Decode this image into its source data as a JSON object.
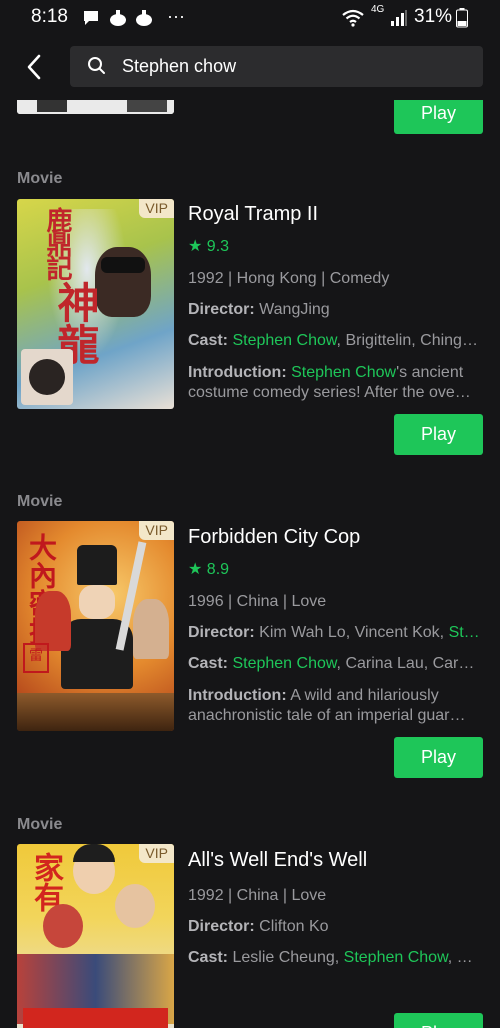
{
  "status_bar": {
    "time": "8:18",
    "more": "···",
    "network": "4G",
    "battery": "31%"
  },
  "search": {
    "value": "Stephen chow"
  },
  "play_label": "Play",
  "section_label": "Movie",
  "labels": {
    "director": "Director:",
    "cast": "Cast:",
    "introduction": "Introduction:"
  },
  "highlight_color": "#1ec659",
  "results": [
    {
      "vip": "VIP",
      "title": "Royal Tramp II",
      "rating": "9.3",
      "meta": "1992 | Hong Kong | Comedy",
      "director": "WangJing",
      "cast_hl": "Stephen Chow",
      "cast_rest": ", Brigittelin, Ching…",
      "intro_hl": "Stephen Chow",
      "intro_rest1": "'s ancient",
      "intro_rest2": "costume comedy series! After the ove…"
    },
    {
      "vip": "VIP",
      "title": "Forbidden City Cop",
      "rating": "8.9",
      "meta": "1996 | China | Love",
      "director": "Kim Wah Lo, Vincent Kok, ",
      "director_hl": "St…",
      "cast_hl": "Stephen Chow",
      "cast_rest": ", Carina Lau, Carm…",
      "intro_line1": "A wild and hilariously",
      "intro_line2": "anachronistic tale of an imperial guar…"
    },
    {
      "vip": "VIP",
      "title": "All's Well End's Well",
      "meta": "1992 | China | Love",
      "director": "Clifton Ko",
      "cast_pre": "Leslie Cheung, ",
      "cast_hl": "Stephen Chow",
      "cast_rest": ", M…"
    }
  ]
}
